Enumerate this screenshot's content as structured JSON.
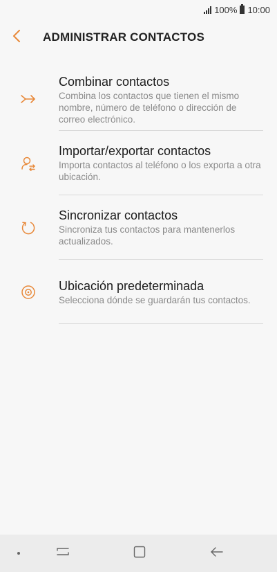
{
  "status_bar": {
    "battery_percent": "100%",
    "time": "10:00"
  },
  "header": {
    "title": "ADMINISTRAR CONTACTOS",
    "back_icon": "chevron-left-icon"
  },
  "items": [
    {
      "title": "Combinar contactos",
      "description": "Combina los contactos que tienen el mismo nombre, número de teléfono o dirección de correo electrónico.",
      "icon": "merge-icon"
    },
    {
      "title": "Importar/exportar contactos",
      "description": "Importa contactos al teléfono o los exporta a otra ubicación.",
      "icon": "import-export-icon"
    },
    {
      "title": "Sincronizar contactos",
      "description": "Sincroniza tus contactos para mantenerlos actualizados.",
      "icon": "sync-icon"
    },
    {
      "title": "Ubicación predeterminada",
      "description": "Selecciona dónde se guardarán tus contactos.",
      "icon": "location-icon"
    }
  ],
  "colors": {
    "accent": "#e8893a",
    "background": "#f7f7f7",
    "nav_bar": "#ececec"
  }
}
